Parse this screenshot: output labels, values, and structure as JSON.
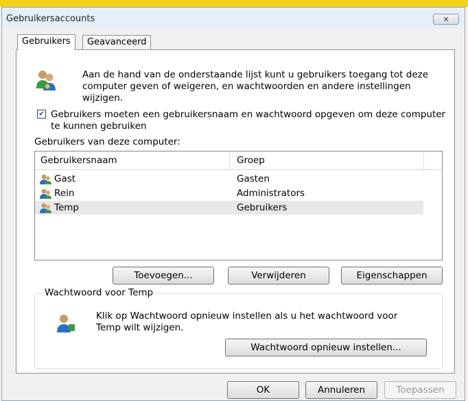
{
  "window": {
    "title": "Gebruikersaccounts",
    "close_label": "✕"
  },
  "tabs": [
    {
      "label": "Gebruikers",
      "active": true
    },
    {
      "label": "Geavanceerd",
      "active": false
    }
  ],
  "intro": {
    "text": "Aan de hand van de onderstaande lijst kunt u gebruikers toegang tot deze computer geven of weigeren, en wachtwoorden en andere instellingen wijzigen."
  },
  "require_login": {
    "checked": true,
    "label": "Gebruikers moeten een gebruikersnaam en wachtwoord opgeven om deze computer te kunnen gebruiken"
  },
  "users_list": {
    "label": "Gebruikers van deze computer:",
    "columns": [
      "Gebruikersnaam",
      "Groep"
    ],
    "rows": [
      {
        "name": "Gast",
        "group": "Gasten",
        "selected": false
      },
      {
        "name": "Rein",
        "group": "Administrators",
        "selected": false
      },
      {
        "name": "Temp",
        "group": "Gebruikers",
        "selected": true
      }
    ]
  },
  "list_buttons": {
    "add": "Toevoegen...",
    "remove": "Verwijderen",
    "properties": "Eigenschappen"
  },
  "password_group": {
    "legend": "Wachtwoord voor Temp",
    "text": "Klik op Wachtwoord opnieuw instellen als u het wachtwoord voor Temp wilt wijzigen.",
    "reset_button": "Wachtwoord opnieuw instellen..."
  },
  "dialog_buttons": {
    "ok": "OK",
    "cancel": "Annuleren",
    "apply": "Toepassen"
  },
  "colors": {
    "accent_bar": "#f5d21a",
    "icon_blue": "#2a6fc4",
    "icon_green": "#3e9a3e"
  }
}
